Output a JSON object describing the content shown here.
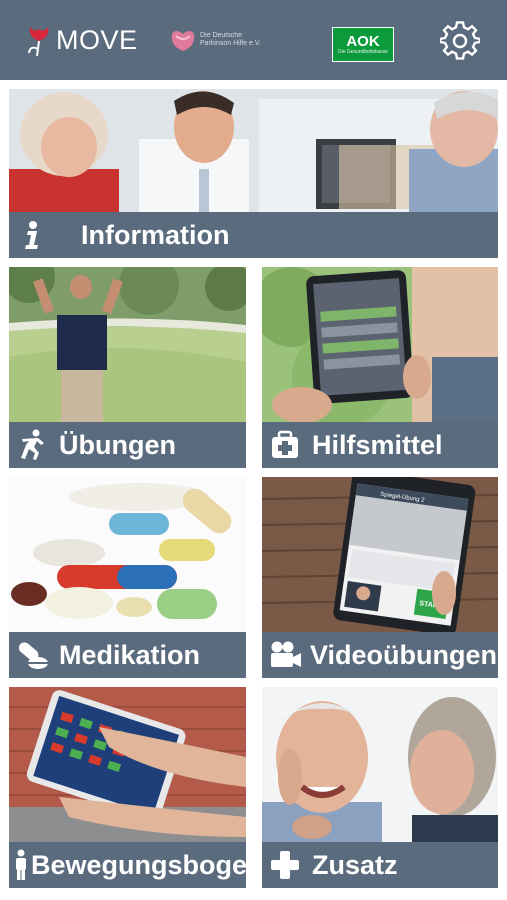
{
  "header": {
    "brand": "MOVE",
    "partner_name": "Die Deutsche Parkinson Hilfe e.V.",
    "insurer_name": "AOK",
    "insurer_tagline": "Die Gesundheitskasse",
    "settings_icon": "gear-icon"
  },
  "tiles": {
    "information": {
      "label": "Information",
      "icon": "info-icon"
    },
    "uebungen": {
      "label": "Übungen",
      "icon": "runner-icon"
    },
    "hilfsmittel": {
      "label": "Hilfsmittel",
      "icon": "first-aid-kit-icon"
    },
    "medikation": {
      "label": "Medikation",
      "icon": "pill-icon"
    },
    "videouebungen": {
      "label": "Videoübungen",
      "icon": "video-camera-icon",
      "tablet_title": "Spiegel-Übung 2",
      "tablet_button": "START"
    },
    "bewegungsbogen": {
      "label": "Bewegungsbogen",
      "icon": "person-icon"
    },
    "zusatz": {
      "label": "Zusatz",
      "icon": "plus-icon"
    }
  },
  "colors": {
    "bar": "#5b6b7e",
    "header": "#5b6b7e",
    "aok_green": "#0b9a3c"
  }
}
